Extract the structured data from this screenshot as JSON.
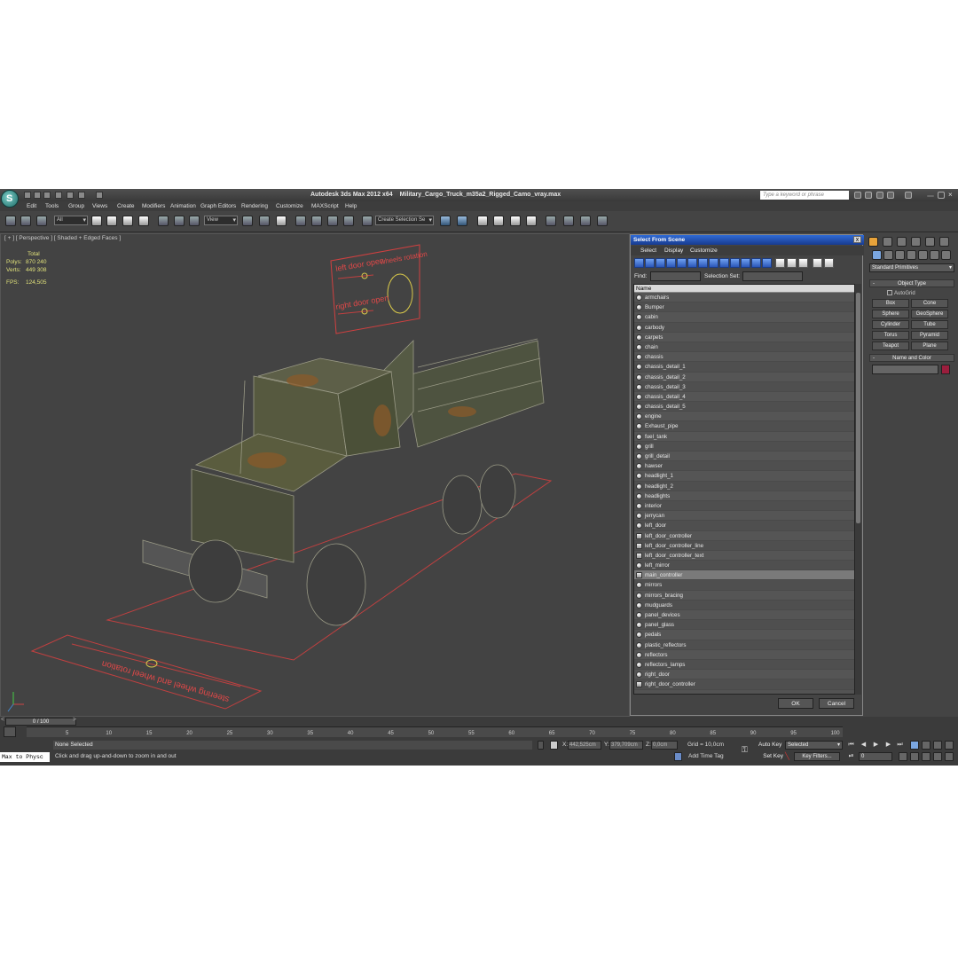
{
  "app": {
    "title": "Autodesk 3ds Max  2012 x64",
    "file": "Military_Cargo_Truck_m35a2_Rigged_Camo_vray.max",
    "help_placeholder": "Type a keyword or phrase",
    "logo_letter": "S"
  },
  "menu": [
    "Edit",
    "Tools",
    "Group",
    "Views",
    "Create",
    "Modifiers",
    "Animation",
    "Graph Editors",
    "Rendering",
    "Customize",
    "MAXScript",
    "Help"
  ],
  "toolbar": {
    "filter": "All",
    "ref_coord": "View",
    "selection_set": "Create Selection Se"
  },
  "viewport": {
    "label": "[ + ] [ Perspective ] [ Shaded + Edged Faces ]",
    "stats": {
      "total_label": "Total",
      "polys_label": "Polys:",
      "polys": "870 240",
      "verts_label": "Verts:",
      "verts": "449 308",
      "fps_label": "FPS:",
      "fps": "124,505"
    },
    "controllers": {
      "left_door": "left door open",
      "wheels": "wheels rotation",
      "right_door": "right door open",
      "steering": "steering wheel and wheel rotation"
    }
  },
  "dialog": {
    "title": "Select From Scene",
    "close": "x",
    "menu": [
      "Select",
      "Display",
      "Customize"
    ],
    "find_label": "Find:",
    "selset_label": "Selection Set:",
    "column": "Name",
    "items": [
      {
        "name": "armchairs",
        "icon": "sphere"
      },
      {
        "name": "Bumper",
        "icon": "sphere"
      },
      {
        "name": "cabin",
        "icon": "sphere"
      },
      {
        "name": "carbody",
        "icon": "sphere"
      },
      {
        "name": "carpets",
        "icon": "sphere"
      },
      {
        "name": "chain",
        "icon": "sphere"
      },
      {
        "name": "chassis",
        "icon": "sphere"
      },
      {
        "name": "chassis_detail_1",
        "icon": "sphere"
      },
      {
        "name": "chassis_detail_2",
        "icon": "sphere"
      },
      {
        "name": "chassis_detail_3",
        "icon": "sphere"
      },
      {
        "name": "chassis_detail_4",
        "icon": "sphere"
      },
      {
        "name": "chassis_detail_5",
        "icon": "sphere"
      },
      {
        "name": "engine",
        "icon": "sphere"
      },
      {
        "name": "Exhaust_pipe",
        "icon": "sphere"
      },
      {
        "name": "fuel_tank",
        "icon": "sphere"
      },
      {
        "name": "grill",
        "icon": "sphere"
      },
      {
        "name": "grill_detail",
        "icon": "sphere"
      },
      {
        "name": "hawser",
        "icon": "sphere"
      },
      {
        "name": "headlight_1",
        "icon": "sphere"
      },
      {
        "name": "headlight_2",
        "icon": "sphere"
      },
      {
        "name": "headlights",
        "icon": "sphere"
      },
      {
        "name": "interior",
        "icon": "sphere"
      },
      {
        "name": "jerrycan",
        "icon": "sphere"
      },
      {
        "name": "left_door",
        "icon": "sphere"
      },
      {
        "name": "left_door_controller",
        "icon": "shape"
      },
      {
        "name": "left_door_controller_line",
        "icon": "shape"
      },
      {
        "name": "left_door_controller_text",
        "icon": "shape"
      },
      {
        "name": "left_mirror",
        "icon": "sphere"
      },
      {
        "name": "main_controller",
        "icon": "shape",
        "selected": true
      },
      {
        "name": "mirrors",
        "icon": "sphere"
      },
      {
        "name": "mirrors_bracing",
        "icon": "sphere"
      },
      {
        "name": "mudguards",
        "icon": "sphere"
      },
      {
        "name": "panel_devices",
        "icon": "sphere"
      },
      {
        "name": "panel_glass",
        "icon": "sphere"
      },
      {
        "name": "pedals",
        "icon": "sphere"
      },
      {
        "name": "plastic_reflectors",
        "icon": "sphere"
      },
      {
        "name": "reflectors",
        "icon": "sphere"
      },
      {
        "name": "reflectors_lamps",
        "icon": "sphere"
      },
      {
        "name": "right_door",
        "icon": "sphere"
      },
      {
        "name": "right_door_controller",
        "icon": "shape"
      }
    ],
    "ok": "OK",
    "cancel": "Cancel"
  },
  "command_panel": {
    "category": "Standard Primitives",
    "object_type": "Object Type",
    "autogrid": "AutoGrid",
    "buttons": [
      "Box",
      "Cone",
      "Sphere",
      "GeoSphere",
      "Cylinder",
      "Tube",
      "Torus",
      "Pyramid",
      "Teapot",
      "Plane"
    ],
    "name_color": "Name and Color",
    "swatch_color": "#9b1e3d"
  },
  "timeline": {
    "slider": "0 / 100",
    "ticks": [
      "5",
      "10",
      "15",
      "20",
      "25",
      "30",
      "35",
      "40",
      "45",
      "50",
      "55",
      "60",
      "65",
      "70",
      "75",
      "80",
      "85",
      "90",
      "95",
      "100"
    ]
  },
  "status": {
    "maxscript": "Max to Physc",
    "selection": "None Selected",
    "prompt": "Click and drag up-and-down to zoom in and out",
    "x_label": "X:",
    "x": "442,525cm",
    "y_label": "Y:",
    "y": "379,709cm",
    "z_label": "Z:",
    "z": "0,0cm",
    "grid": "Grid = 10,0cm",
    "add_time_tag": "Add Time Tag",
    "auto_key": "Auto Key",
    "set_key": "Set Key",
    "selected": "Selected",
    "key_filters": "Key Filters...",
    "frame": "0"
  }
}
